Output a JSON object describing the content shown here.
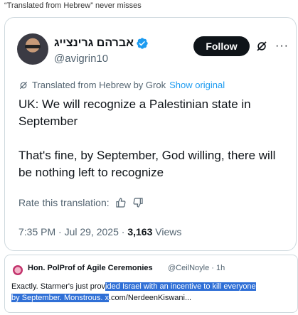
{
  "caption": "“Translated from Hebrew” never misses",
  "tweet": {
    "display_name": "אברהם גרינצייג",
    "handle": "@avigrin10",
    "follow_label": "Follow",
    "more_label": "···",
    "translated_label": "Translated from Hebrew by Grok",
    "show_original_label": "Show original",
    "paragraph_1": "UK: We will recognize a Palestinian state in September",
    "paragraph_2": "That's fine, by September, God willing, there will be nothing left to recognize",
    "rate_label": "Rate this translation:",
    "time": "7:35 PM",
    "date": "Jul 29, 2025",
    "views_count": "3,163",
    "views_label": "Views",
    "separator": "·"
  },
  "quote": {
    "name": "Hon. PolProf of Agile Ceremonies",
    "handle_time": "@CeilNoyle · 1h",
    "text_plain_1": "Exactly. Starmer's just prov",
    "text_hl_1": "ided Israel with an incentive to kill everyone",
    "text_hl_2": "by September. Monstrous. x",
    "text_plain_2": ".com/NerdeenKiswani..."
  },
  "colors": {
    "accent": "#1d9bf0",
    "follow_bg": "#0f1419",
    "selection": "#2f6fd6",
    "muted": "#536471"
  },
  "icons": [
    "verified-badge-icon",
    "grok-icon",
    "more-icon",
    "thumbs-up-icon",
    "thumbs-down-icon"
  ]
}
